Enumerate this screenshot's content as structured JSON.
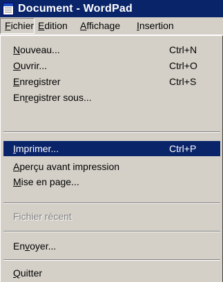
{
  "window": {
    "title": "Document - WordPad",
    "icon": "wordpad-icon"
  },
  "menubar": [
    {
      "pre": "",
      "mn": "F",
      "post": "ichier",
      "active": true
    },
    {
      "pre": "",
      "mn": "E",
      "post": "dition",
      "active": false
    },
    {
      "pre": "",
      "mn": "A",
      "post": "ffichage",
      "active": false
    },
    {
      "pre": "",
      "mn": "I",
      "post": "nsertion",
      "active": false
    }
  ],
  "menu": {
    "items": [
      {
        "pre": "",
        "mn": "N",
        "post": "ouveau...",
        "shortcut": "Ctrl+N"
      },
      {
        "pre": "",
        "mn": "O",
        "post": "uvrir...",
        "shortcut": "Ctrl+O"
      },
      {
        "pre": "",
        "mn": "E",
        "post": "nregistrer",
        "shortcut": "Ctrl+S"
      },
      {
        "pre": "En",
        "mn": "r",
        "post": "egistrer sous...",
        "shortcut": ""
      },
      {
        "pre": "",
        "mn": "I",
        "post": "mprimer...",
        "shortcut": "Ctrl+P",
        "highlighted": true
      },
      {
        "pre": "",
        "mn": "A",
        "post": "perçu avant impression",
        "shortcut": ""
      },
      {
        "pre": "",
        "mn": "M",
        "post": "ise en page...",
        "shortcut": ""
      },
      {
        "pre": "Fichier récent",
        "mn": "",
        "post": "",
        "shortcut": "",
        "disabled": true
      },
      {
        "pre": "En",
        "mn": "v",
        "post": "oyer...",
        "shortcut": ""
      },
      {
        "pre": "",
        "mn": "Q",
        "post": "uitter",
        "shortcut": ""
      }
    ]
  }
}
